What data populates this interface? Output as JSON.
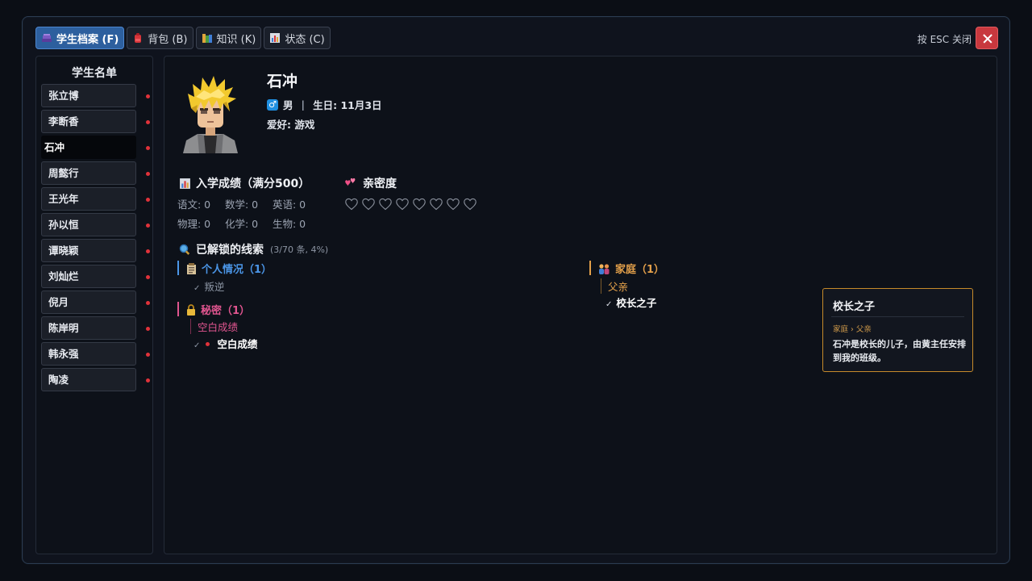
{
  "tabs": [
    {
      "label": "学生档案 (F)",
      "icon": "archive-icon",
      "active": true
    },
    {
      "label": "背包 (B)",
      "icon": "backpack-icon",
      "active": false
    },
    {
      "label": "知识 (K)",
      "icon": "books-icon",
      "active": false
    },
    {
      "label": "状态 (C)",
      "icon": "chart-icon",
      "active": false
    }
  ],
  "close_hint": "按 ESC 关闭",
  "sidebar": {
    "title": "学生名单",
    "students": [
      "张立博",
      "李断香",
      "石冲",
      "周懿行",
      "王光年",
      "孙以恒",
      "谭晓颖",
      "刘灿烂",
      "倪月",
      "陈岸明",
      "韩永强",
      "陶凌"
    ],
    "selected": "石冲"
  },
  "profile": {
    "name": "石冲",
    "gender_icon": "♂",
    "gender": "男",
    "sep": "|",
    "birthday": "生日: 11月3日",
    "hobby": "爱好: 游戏"
  },
  "scores": {
    "title": "入学成绩（满分500）",
    "row1": [
      "语文: 0",
      "数学: 0",
      "英语: 0"
    ],
    "row2": [
      "物理: 0",
      "化学: 0",
      "生物: 0"
    ]
  },
  "intimacy": {
    "title": "亲密度",
    "level": 0,
    "max": 8
  },
  "clues": {
    "title": "已解锁的线索",
    "count": "(3/70 条, 4%)",
    "personal": {
      "title": "个人情况（1）",
      "items": [
        "叛逆"
      ],
      "color": "#4b96e8"
    },
    "secret": {
      "title": "秘密（1）",
      "sub": "空白成绩",
      "items": [
        "空白成绩"
      ],
      "color": "#e0558f"
    },
    "family": {
      "title": "家庭（1）",
      "sub": "父亲",
      "items": [
        "校长之子"
      ],
      "color": "#e3a04a"
    },
    "check": "✓"
  },
  "tooltip": {
    "title": "校长之子",
    "path": "家庭 › 父亲",
    "body": "石冲是校长的儿子，由黄主任安排到我的班级。"
  },
  "colors": {
    "accent": "#2d5f9e",
    "close": "#c8383e",
    "new_dot": "#e0323a",
    "tooltip_border": "#c68a2a"
  }
}
